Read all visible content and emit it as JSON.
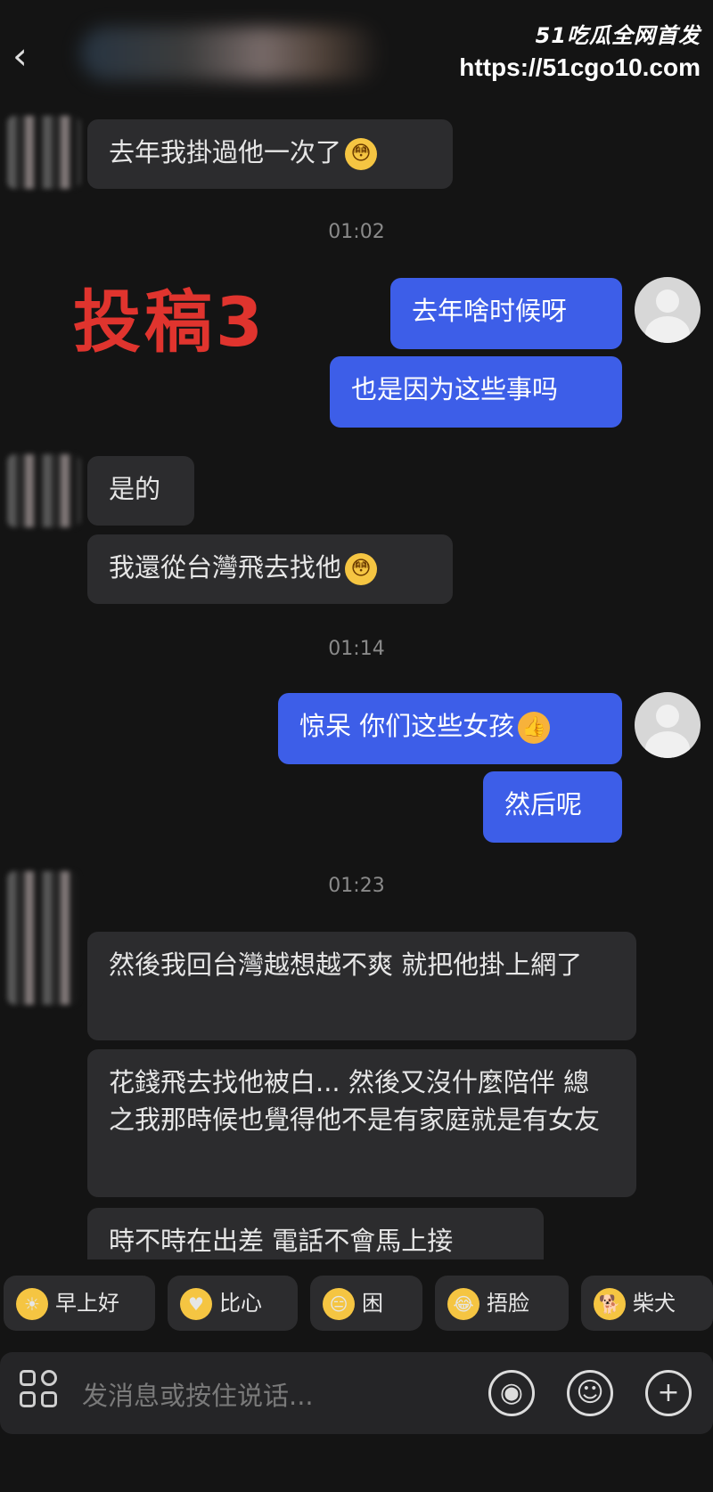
{
  "header": {
    "back_glyph": "‹"
  },
  "watermark": {
    "logo": "51",
    "logo_tag": "吃瓜全网首发",
    "url": "https://51cgo10.com"
  },
  "stamp": "投稿3",
  "messages": [
    {
      "side": "left",
      "text": "去年我掛過他一次了",
      "emoji": "😳"
    },
    {
      "side": "time",
      "text": "01:02"
    },
    {
      "side": "right",
      "text": "去年啥时候呀"
    },
    {
      "side": "right",
      "text": "也是因为这些事吗"
    },
    {
      "side": "left",
      "text": "是的"
    },
    {
      "side": "left",
      "text": "我還從台灣飛去找他",
      "emoji": "😳"
    },
    {
      "side": "time",
      "text": "01:14"
    },
    {
      "side": "right",
      "text": "惊呆 你们这些女孩",
      "emoji": "👍"
    },
    {
      "side": "right",
      "text": "然后呢"
    },
    {
      "side": "time",
      "text": "01:23"
    },
    {
      "side": "left",
      "text": "然後我回台灣越想越不爽 就把他掛上網了"
    },
    {
      "side": "left",
      "text": "花錢飛去找他被白... 然後又沒什麼陪伴 總之我那時候也覺得他不是有家庭就是有女友"
    },
    {
      "side": "left",
      "text": "時不時在出差 電話不會馬上接"
    }
  ],
  "quick_replies": [
    {
      "icon": "sun-cloud-icon",
      "glyph": "☀",
      "label": "早上好"
    },
    {
      "icon": "heart-hand-icon",
      "glyph": "♥",
      "label": "比心"
    },
    {
      "icon": "sleepy-face-icon",
      "glyph": "😑",
      "label": "困"
    },
    {
      "icon": "facepalm-icon",
      "glyph": "😂",
      "label": "捂脸"
    },
    {
      "icon": "shiba-icon",
      "glyph": "🐕",
      "label": "柴犬"
    }
  ],
  "input": {
    "placeholder": "发消息或按住说话..."
  },
  "colors": {
    "bubble_right": "#3d5ee8",
    "bubble_left": "#2c2c2e",
    "stamp": "#e0342e",
    "background": "#141414"
  }
}
